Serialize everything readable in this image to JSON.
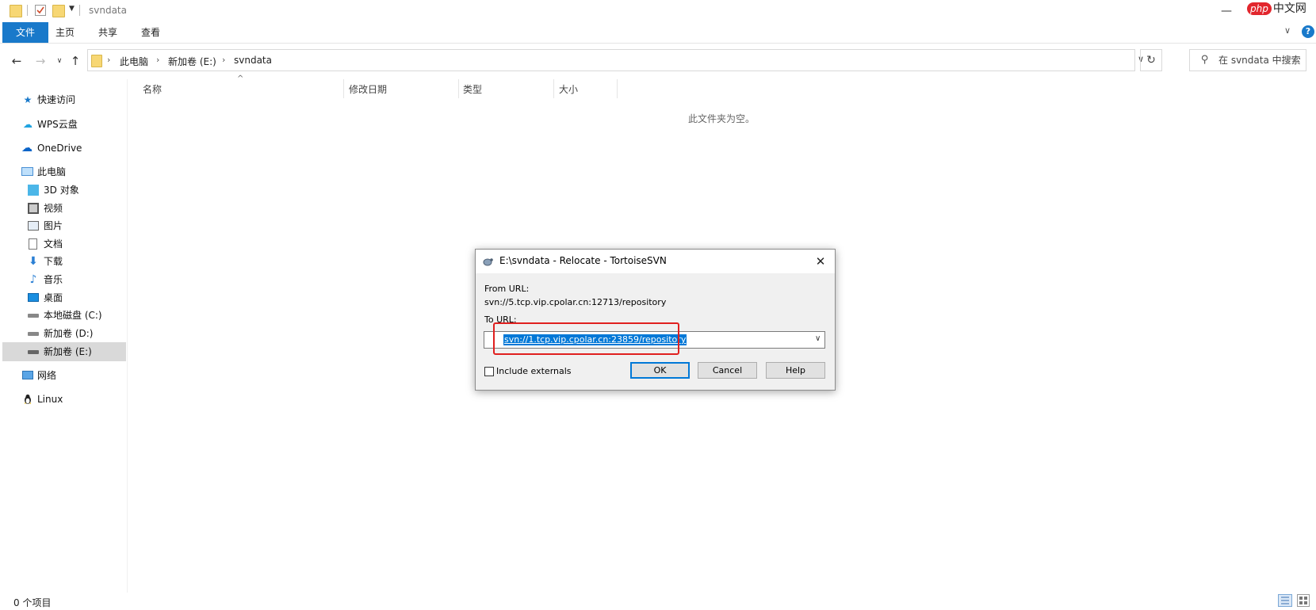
{
  "window": {
    "title": "svndata"
  },
  "logo": {
    "text_php": "php",
    "text_cn": "中文网"
  },
  "ribbon": {
    "tabs": [
      "文件",
      "主页",
      "共享",
      "查看"
    ],
    "help": "?"
  },
  "address": {
    "crumbs": [
      "此电脑",
      "新加卷 (E:)",
      "svndata"
    ],
    "search_placeholder": "在 svndata 中搜索"
  },
  "sidebar": {
    "items": [
      {
        "label": "快速访问",
        "icon": "star-icon"
      },
      {
        "label": "WPS云盘",
        "icon": "cloud-icon"
      },
      {
        "label": "OneDrive",
        "icon": "onedrive-icon"
      },
      {
        "label": "此电脑",
        "icon": "computer-icon"
      },
      {
        "label": "3D 对象",
        "icon": "cube-icon"
      },
      {
        "label": "视频",
        "icon": "film-icon"
      },
      {
        "label": "图片",
        "icon": "picture-icon"
      },
      {
        "label": "文档",
        "icon": "document-icon"
      },
      {
        "label": "下载",
        "icon": "download-icon"
      },
      {
        "label": "音乐",
        "icon": "music-icon"
      },
      {
        "label": "桌面",
        "icon": "desktop-icon"
      },
      {
        "label": "本地磁盘 (C:)",
        "icon": "drive-icon"
      },
      {
        "label": "新加卷 (D:)",
        "icon": "drive-icon"
      },
      {
        "label": "新加卷 (E:)",
        "icon": "drive-icon"
      },
      {
        "label": "网络",
        "icon": "network-icon"
      },
      {
        "label": "Linux",
        "icon": "linux-icon"
      }
    ]
  },
  "columns": [
    "名称",
    "修改日期",
    "类型",
    "大小"
  ],
  "empty_message": "此文件夹为空。",
  "status": {
    "item_count": "0 个项目"
  },
  "dialog": {
    "title": "E:\\svndata - Relocate - TortoiseSVN",
    "from_label": "From URL:",
    "from_url": "svn://5.tcp.vip.cpolar.cn:12713/repository",
    "to_label": "To URL:",
    "to_url": "svn://1.tcp.vip.cpolar.cn:23859/repository",
    "checkbox_label": "Include externals",
    "buttons": {
      "ok": "OK",
      "cancel": "Cancel",
      "help": "Help"
    }
  }
}
